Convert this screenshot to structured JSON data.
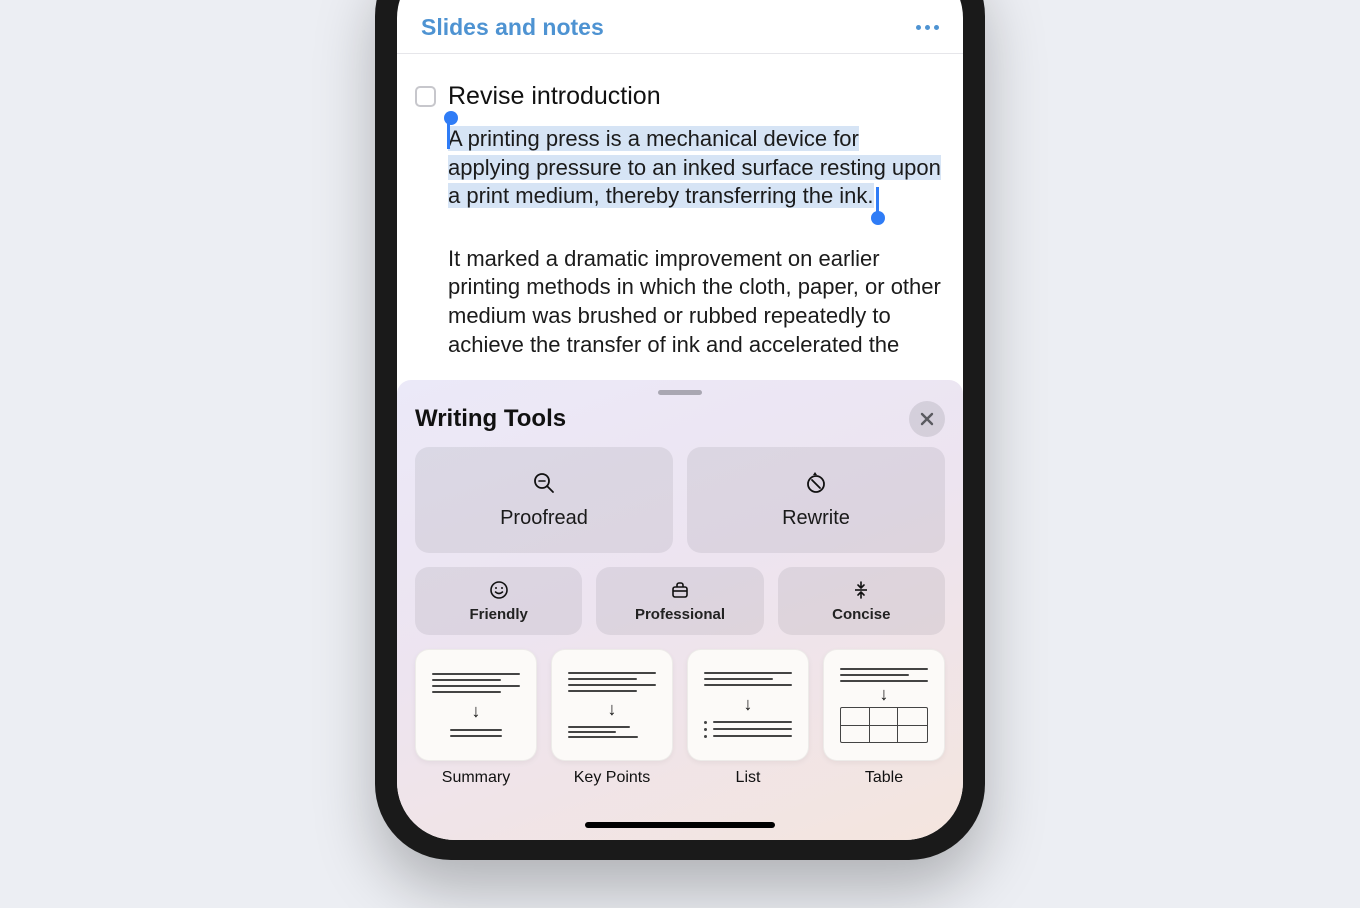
{
  "header": {
    "title": "Slides and notes"
  },
  "document": {
    "task_title": "Revise introduction",
    "selected_paragraph": "A printing press is a mechanical device for applying pressure to an inked surface resting upon a print medium, thereby transferring the ink.",
    "paragraph_2": "It marked a dramatic improvement on earlier printing methods in which the cloth, paper, or other medium was brushed or rubbed repeatedly to achieve the transfer of ink and accelerated the"
  },
  "sheet": {
    "title": "Writing Tools",
    "primary": [
      {
        "label": "Proofread",
        "icon": "magnifier"
      },
      {
        "label": "Rewrite",
        "icon": "rewrite"
      }
    ],
    "tone": [
      {
        "label": "Friendly",
        "icon": "smile"
      },
      {
        "label": "Professional",
        "icon": "briefcase"
      },
      {
        "label": "Concise",
        "icon": "condense"
      }
    ],
    "transforms": [
      {
        "label": "Summary"
      },
      {
        "label": "Key Points"
      },
      {
        "label": "List"
      },
      {
        "label": "Table"
      }
    ]
  },
  "colors": {
    "accent": "#4E93D2",
    "selection": "#D6E4F5",
    "handle": "#2F7CF6"
  }
}
